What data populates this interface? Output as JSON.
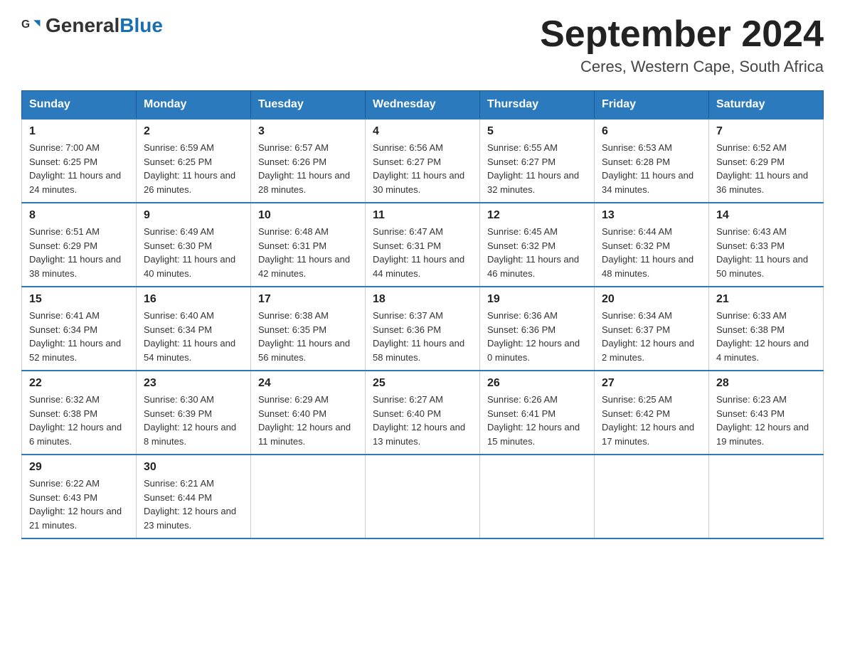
{
  "header": {
    "logo": {
      "text_general": "General",
      "text_blue": "Blue"
    },
    "title": "September 2024",
    "location": "Ceres, Western Cape, South Africa"
  },
  "days_of_week": [
    "Sunday",
    "Monday",
    "Tuesday",
    "Wednesday",
    "Thursday",
    "Friday",
    "Saturday"
  ],
  "weeks": [
    [
      {
        "day": "1",
        "sunrise": "7:00 AM",
        "sunset": "6:25 PM",
        "daylight": "11 hours and 24 minutes."
      },
      {
        "day": "2",
        "sunrise": "6:59 AM",
        "sunset": "6:25 PM",
        "daylight": "11 hours and 26 minutes."
      },
      {
        "day": "3",
        "sunrise": "6:57 AM",
        "sunset": "6:26 PM",
        "daylight": "11 hours and 28 minutes."
      },
      {
        "day": "4",
        "sunrise": "6:56 AM",
        "sunset": "6:27 PM",
        "daylight": "11 hours and 30 minutes."
      },
      {
        "day": "5",
        "sunrise": "6:55 AM",
        "sunset": "6:27 PM",
        "daylight": "11 hours and 32 minutes."
      },
      {
        "day": "6",
        "sunrise": "6:53 AM",
        "sunset": "6:28 PM",
        "daylight": "11 hours and 34 minutes."
      },
      {
        "day": "7",
        "sunrise": "6:52 AM",
        "sunset": "6:29 PM",
        "daylight": "11 hours and 36 minutes."
      }
    ],
    [
      {
        "day": "8",
        "sunrise": "6:51 AM",
        "sunset": "6:29 PM",
        "daylight": "11 hours and 38 minutes."
      },
      {
        "day": "9",
        "sunrise": "6:49 AM",
        "sunset": "6:30 PM",
        "daylight": "11 hours and 40 minutes."
      },
      {
        "day": "10",
        "sunrise": "6:48 AM",
        "sunset": "6:31 PM",
        "daylight": "11 hours and 42 minutes."
      },
      {
        "day": "11",
        "sunrise": "6:47 AM",
        "sunset": "6:31 PM",
        "daylight": "11 hours and 44 minutes."
      },
      {
        "day": "12",
        "sunrise": "6:45 AM",
        "sunset": "6:32 PM",
        "daylight": "11 hours and 46 minutes."
      },
      {
        "day": "13",
        "sunrise": "6:44 AM",
        "sunset": "6:32 PM",
        "daylight": "11 hours and 48 minutes."
      },
      {
        "day": "14",
        "sunrise": "6:43 AM",
        "sunset": "6:33 PM",
        "daylight": "11 hours and 50 minutes."
      }
    ],
    [
      {
        "day": "15",
        "sunrise": "6:41 AM",
        "sunset": "6:34 PM",
        "daylight": "11 hours and 52 minutes."
      },
      {
        "day": "16",
        "sunrise": "6:40 AM",
        "sunset": "6:34 PM",
        "daylight": "11 hours and 54 minutes."
      },
      {
        "day": "17",
        "sunrise": "6:38 AM",
        "sunset": "6:35 PM",
        "daylight": "11 hours and 56 minutes."
      },
      {
        "day": "18",
        "sunrise": "6:37 AM",
        "sunset": "6:36 PM",
        "daylight": "11 hours and 58 minutes."
      },
      {
        "day": "19",
        "sunrise": "6:36 AM",
        "sunset": "6:36 PM",
        "daylight": "12 hours and 0 minutes."
      },
      {
        "day": "20",
        "sunrise": "6:34 AM",
        "sunset": "6:37 PM",
        "daylight": "12 hours and 2 minutes."
      },
      {
        "day": "21",
        "sunrise": "6:33 AM",
        "sunset": "6:38 PM",
        "daylight": "12 hours and 4 minutes."
      }
    ],
    [
      {
        "day": "22",
        "sunrise": "6:32 AM",
        "sunset": "6:38 PM",
        "daylight": "12 hours and 6 minutes."
      },
      {
        "day": "23",
        "sunrise": "6:30 AM",
        "sunset": "6:39 PM",
        "daylight": "12 hours and 8 minutes."
      },
      {
        "day": "24",
        "sunrise": "6:29 AM",
        "sunset": "6:40 PM",
        "daylight": "12 hours and 11 minutes."
      },
      {
        "day": "25",
        "sunrise": "6:27 AM",
        "sunset": "6:40 PM",
        "daylight": "12 hours and 13 minutes."
      },
      {
        "day": "26",
        "sunrise": "6:26 AM",
        "sunset": "6:41 PM",
        "daylight": "12 hours and 15 minutes."
      },
      {
        "day": "27",
        "sunrise": "6:25 AM",
        "sunset": "6:42 PM",
        "daylight": "12 hours and 17 minutes."
      },
      {
        "day": "28",
        "sunrise": "6:23 AM",
        "sunset": "6:43 PM",
        "daylight": "12 hours and 19 minutes."
      }
    ],
    [
      {
        "day": "29",
        "sunrise": "6:22 AM",
        "sunset": "6:43 PM",
        "daylight": "12 hours and 21 minutes."
      },
      {
        "day": "30",
        "sunrise": "6:21 AM",
        "sunset": "6:44 PM",
        "daylight": "12 hours and 23 minutes."
      },
      null,
      null,
      null,
      null,
      null
    ]
  ],
  "labels": {
    "sunrise": "Sunrise:",
    "sunset": "Sunset:",
    "daylight": "Daylight:"
  }
}
